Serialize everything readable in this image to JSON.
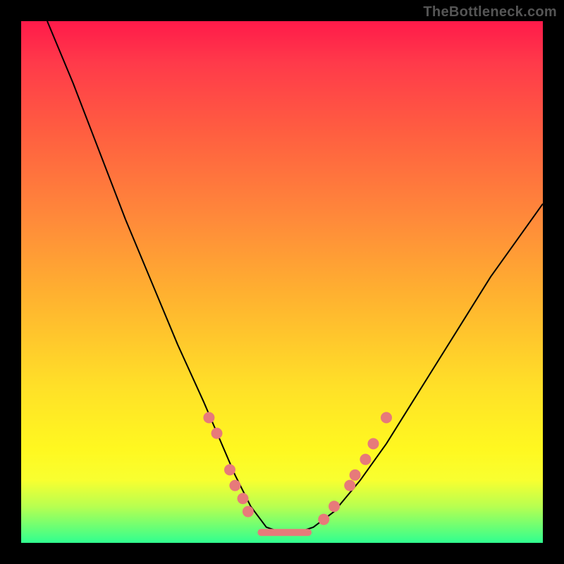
{
  "watermark": "TheBottleneck.com",
  "chart_data": {
    "type": "line",
    "title": "",
    "xlabel": "",
    "ylabel": "",
    "xlim": [
      0,
      100
    ],
    "ylim": [
      0,
      100
    ],
    "series": [
      {
        "name": "bottleneck-curve",
        "x": [
          5,
          10,
          15,
          20,
          25,
          30,
          35,
          38,
          41,
          44,
          47,
          50,
          53,
          56,
          60,
          65,
          70,
          75,
          80,
          85,
          90,
          95,
          100
        ],
        "y": [
          100,
          88,
          75,
          62,
          50,
          38,
          27,
          20,
          13,
          7,
          3,
          2,
          2,
          3,
          6,
          12,
          19,
          27,
          35,
          43,
          51,
          58,
          65
        ]
      }
    ],
    "markers": {
      "name": "highlight-dots",
      "points": [
        {
          "x": 36,
          "y": 24
        },
        {
          "x": 37.5,
          "y": 21
        },
        {
          "x": 40,
          "y": 14
        },
        {
          "x": 41,
          "y": 11
        },
        {
          "x": 42.5,
          "y": 8.5
        },
        {
          "x": 43.5,
          "y": 6
        },
        {
          "x": 58,
          "y": 4.5
        },
        {
          "x": 60,
          "y": 7
        },
        {
          "x": 63,
          "y": 11
        },
        {
          "x": 64,
          "y": 13
        },
        {
          "x": 66,
          "y": 16
        },
        {
          "x": 67.5,
          "y": 19
        },
        {
          "x": 70,
          "y": 24
        }
      ]
    },
    "flat_bottom": {
      "x_start": 46,
      "x_end": 55,
      "y": 2
    }
  }
}
